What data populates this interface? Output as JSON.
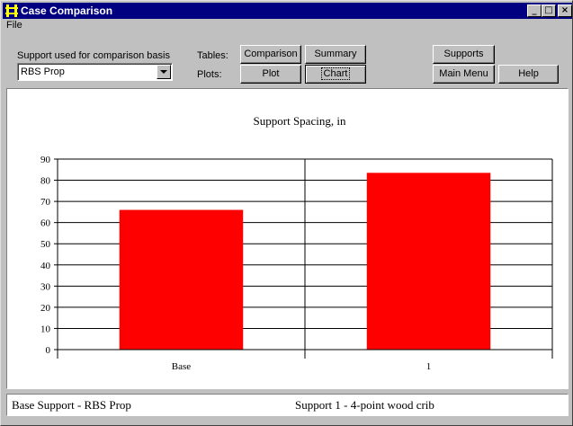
{
  "window": {
    "title": "Case Comparison",
    "controls": {
      "minimize": "_",
      "maximize": "□",
      "close": "×"
    }
  },
  "menu": {
    "file": "File"
  },
  "support": {
    "label": "Support used for comparison basis",
    "selected": "RBS Prop"
  },
  "tables": {
    "label": "Tables:",
    "comparison": "Comparison",
    "summary": "Summary"
  },
  "plots": {
    "label": "Plots:",
    "plot": "Plot",
    "chart": "Chart"
  },
  "nav": {
    "supports": "Supports",
    "main_menu": "Main Menu",
    "help": "Help"
  },
  "chart_data": {
    "type": "bar",
    "title": "Support Spacing, in",
    "categories": [
      "Base",
      "1"
    ],
    "values": [
      66,
      83.5
    ],
    "ylim": [
      0,
      90
    ],
    "yticks": [
      0,
      10,
      20,
      30,
      40,
      50,
      60,
      70,
      80,
      90
    ],
    "grid": true,
    "bar_color": "#ff0000",
    "xlabel": "",
    "ylabel": ""
  },
  "status": {
    "base": "Base Support - RBS Prop",
    "support1": "Support 1 - 4-point wood crib"
  },
  "colors": {
    "titlebar": "#000080",
    "face": "#c0c0c0",
    "bar": "#ff0000"
  }
}
